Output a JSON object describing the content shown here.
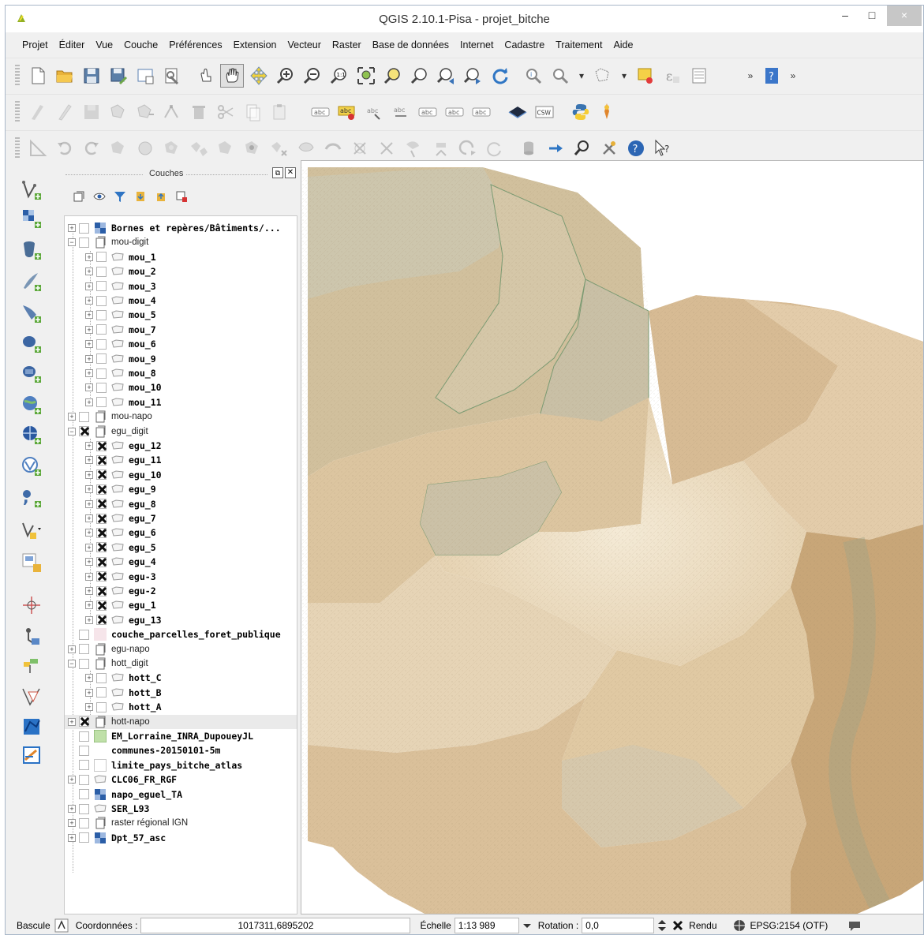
{
  "window": {
    "title": "QGIS 2.10.1-Pisa - projet_bitche",
    "minimize": "–",
    "maximize": "□",
    "close": "×"
  },
  "menu": [
    "Projet",
    "Éditer",
    "Vue",
    "Couche",
    "Préférences",
    "Extension",
    "Vecteur",
    "Raster",
    "Base de données",
    "Internet",
    "Cadastre",
    "Traitement",
    "Aide"
  ],
  "toolbars": {
    "overflow": "»",
    "file": [
      "new-project-icon",
      "open-project-icon",
      "save-project-icon",
      "save-as-icon",
      "print-composer-icon",
      "composer-manager-icon"
    ],
    "navigation": [
      "touch-icon",
      "pan-icon",
      "pan-to-selection-icon",
      "zoom-in-icon",
      "zoom-out-icon",
      "zoom-actual-icon",
      "zoom-full-icon",
      "zoom-to-selection-icon",
      "zoom-to-layer-icon",
      "zoom-last-icon",
      "zoom-next-icon",
      "refresh-icon"
    ],
    "attributes": [
      "identify-icon",
      "select-icon",
      "deselect-icon",
      "open-table-icon",
      "measure-icon",
      "statistics-icon"
    ],
    "help": "help-icon",
    "edit": [
      "current-edits-icon",
      "toggle-editing-icon",
      "save-edits-icon",
      "add-feature-icon",
      "move-feature-icon",
      "node-tool-icon",
      "delete-icon",
      "cut-icon",
      "copy-icon",
      "paste-icon"
    ],
    "labels": {
      "items": [
        "label-tool-icon",
        "pin-label-icon",
        "highlight-label-icon",
        "move-label-icon",
        "rotate-label-icon",
        "change-label-icon",
        "show-hide-label-icon"
      ],
      "text": "abc"
    },
    "web": {
      "catalog": "catalog-icon",
      "csw_text": "CSW"
    },
    "plugins": [
      "python-icon",
      "spatialite-icon"
    ],
    "advanced": [
      "digitize-icon",
      "undo-icon",
      "redo-icon",
      "rotate-feature-icon",
      "simplify-icon",
      "add-ring-icon",
      "add-part-icon",
      "fill-ring-icon",
      "delete-ring-icon",
      "delete-part-icon",
      "reshape-icon",
      "offset-curve-icon",
      "split-feature-icon",
      "split-parts-icon",
      "merge-icon",
      "merge-attributes-icon",
      "rotate-symbol-icon",
      "rotate-point-icon",
      "layer-db-icon",
      "arrow-right-icon",
      "search-icon",
      "tools-icon",
      "whats-this-icon"
    ],
    "whats_this_text": "?"
  },
  "vbar": [
    "add-vector-layer-icon",
    "add-raster-layer-icon",
    "add-postgis-icon",
    "add-spatialite-icon",
    "add-mssql-icon",
    "add-oracle-icon",
    "add-db2-icon",
    "add-wms-icon",
    "add-wcs-icon",
    "add-wfs-icon",
    "add-delimited-icon",
    "new-shapefile-icon",
    "create-layer-icon",
    "add-gps-icon",
    "coordinate-capture-icon",
    "geometry-checker-icon",
    "georeferencer-icon",
    "vector-query-icon",
    "add-wfs-alt-icon",
    "heatmap-icon"
  ],
  "layers_panel": {
    "title": "Couches",
    "float_btn": "⧉",
    "close_btn": "✕",
    "tools": [
      "add-group-icon",
      "manage-visibility-icon",
      "filter-legend-icon",
      "expand-all-icon",
      "collapse-all-icon",
      "remove-layer-icon"
    ],
    "rows": [
      {
        "level": 0,
        "expander": "+",
        "checked": false,
        "icon": "raster",
        "name": "Bornes et repères/Bâtiments/...",
        "style": "bold"
      },
      {
        "level": 0,
        "expander": "−",
        "checked": false,
        "icon": "group",
        "name": "mou-digit",
        "style": "group"
      },
      {
        "level": 1,
        "expander": "+",
        "checked": false,
        "icon": "polygon",
        "name": "mou_1",
        "style": "bold"
      },
      {
        "level": 1,
        "expander": "+",
        "checked": false,
        "icon": "polygon",
        "name": "mou_2",
        "style": "bold"
      },
      {
        "level": 1,
        "expander": "+",
        "checked": false,
        "icon": "polygon",
        "name": "mou_3",
        "style": "bold"
      },
      {
        "level": 1,
        "expander": "+",
        "checked": false,
        "icon": "polygon",
        "name": "mou_4",
        "style": "bold"
      },
      {
        "level": 1,
        "expander": "+",
        "checked": false,
        "icon": "polygon",
        "name": "mou_5",
        "style": "bold"
      },
      {
        "level": 1,
        "expander": "+",
        "checked": false,
        "icon": "polygon",
        "name": "mou_7",
        "style": "bold"
      },
      {
        "level": 1,
        "expander": "+",
        "checked": false,
        "icon": "polygon",
        "name": "mou_6",
        "style": "bold"
      },
      {
        "level": 1,
        "expander": "+",
        "checked": false,
        "icon": "polygon",
        "name": "mou_9",
        "style": "bold"
      },
      {
        "level": 1,
        "expander": "+",
        "checked": false,
        "icon": "polygon",
        "name": "mou_8",
        "style": "bold"
      },
      {
        "level": 1,
        "expander": "+",
        "checked": false,
        "icon": "polygon",
        "name": "mou_10",
        "style": "bold"
      },
      {
        "level": 1,
        "expander": "+",
        "checked": false,
        "icon": "polygon",
        "name": "mou_11",
        "style": "bold"
      },
      {
        "level": 0,
        "expander": "+",
        "checked": false,
        "icon": "group",
        "name": "mou-napo",
        "style": "group"
      },
      {
        "level": 0,
        "expander": "−",
        "checked": true,
        "icon": "group",
        "name": "egu_digit",
        "style": "group"
      },
      {
        "level": 1,
        "expander": "+",
        "checked": true,
        "icon": "polygon",
        "name": "egu_12",
        "style": "bold"
      },
      {
        "level": 1,
        "expander": "+",
        "checked": true,
        "icon": "polygon",
        "name": "egu_11",
        "style": "bold"
      },
      {
        "level": 1,
        "expander": "+",
        "checked": true,
        "icon": "polygon",
        "name": "egu_10",
        "style": "bold"
      },
      {
        "level": 1,
        "expander": "+",
        "checked": true,
        "icon": "polygon",
        "name": "egu_9",
        "style": "bold"
      },
      {
        "level": 1,
        "expander": "+",
        "checked": true,
        "icon": "polygon",
        "name": "egu_8",
        "style": "bold"
      },
      {
        "level": 1,
        "expander": "+",
        "checked": true,
        "icon": "polygon",
        "name": "egu_7",
        "style": "bold"
      },
      {
        "level": 1,
        "expander": "+",
        "checked": true,
        "icon": "polygon",
        "name": "egu_6",
        "style": "bold"
      },
      {
        "level": 1,
        "expander": "+",
        "checked": true,
        "icon": "polygon",
        "name": "egu_5",
        "style": "bold"
      },
      {
        "level": 1,
        "expander": "+",
        "checked": true,
        "icon": "polygon",
        "name": "egu_4",
        "style": "bold"
      },
      {
        "level": 1,
        "expander": "+",
        "checked": true,
        "icon": "polygon",
        "name": "egu-3",
        "style": "bold"
      },
      {
        "level": 1,
        "expander": "+",
        "checked": true,
        "icon": "polygon",
        "name": "egu-2",
        "style": "bold"
      },
      {
        "level": 1,
        "expander": "+",
        "checked": true,
        "icon": "polygon",
        "name": "egu_1",
        "style": "bold"
      },
      {
        "level": 1,
        "expander": "+",
        "checked": true,
        "icon": "polygon",
        "name": "egu_13",
        "style": "bold"
      },
      {
        "level": 0,
        "expander": "",
        "checked": false,
        "icon": "pink",
        "name": "couche_parcelles_foret_publique",
        "style": "bold"
      },
      {
        "level": 0,
        "expander": "+",
        "checked": false,
        "icon": "group",
        "name": "egu-napo",
        "style": "group"
      },
      {
        "level": 0,
        "expander": "−",
        "checked": false,
        "icon": "group",
        "name": "hott_digit",
        "style": "group"
      },
      {
        "level": 1,
        "expander": "+",
        "checked": false,
        "icon": "polygon",
        "name": "hott_C",
        "style": "bold"
      },
      {
        "level": 1,
        "expander": "+",
        "checked": false,
        "icon": "polygon",
        "name": "hott_B",
        "style": "bold"
      },
      {
        "level": 1,
        "expander": "+",
        "checked": false,
        "icon": "polygon",
        "name": "hott_A",
        "style": "bold"
      },
      {
        "level": 0,
        "expander": "+",
        "checked": true,
        "icon": "group",
        "name": "hott-napo",
        "style": "group",
        "selected": true
      },
      {
        "level": 0,
        "expander": "",
        "checked": false,
        "icon": "green",
        "name": "EM_Lorraine_INRA_DupoueyJL",
        "style": "bold"
      },
      {
        "level": 0,
        "expander": "",
        "checked": false,
        "icon": "none",
        "name": "communes-20150101-5m",
        "style": "bold"
      },
      {
        "level": 0,
        "expander": "",
        "checked": false,
        "icon": "white",
        "name": "limite_pays_bitche_atlas",
        "style": "bold"
      },
      {
        "level": 0,
        "expander": "+",
        "checked": false,
        "icon": "polygon",
        "name": "CLC06_FR_RGF",
        "style": "bold"
      },
      {
        "level": 0,
        "expander": "",
        "checked": false,
        "icon": "raster",
        "name": "napo_eguel_TA",
        "style": "bold"
      },
      {
        "level": 0,
        "expander": "+",
        "checked": false,
        "icon": "polygon",
        "name": "SER_L93",
        "style": "bold"
      },
      {
        "level": 0,
        "expander": "+",
        "checked": false,
        "icon": "group",
        "name": "raster régional IGN",
        "style": "group"
      },
      {
        "level": 0,
        "expander": "+",
        "checked": false,
        "icon": "raster",
        "name": "Dpt_57_asc",
        "style": "bold"
      }
    ]
  },
  "colors": {
    "map_background": "#ffffff",
    "parchment_light": "#eee2c9",
    "parchment_mid": "#dcc3a0",
    "parchment_dark": "#c9a97e",
    "grey_parcel": "#d2c7b0",
    "boundary_green": "#6f9a6b"
  },
  "statusbar": {
    "toggle_label": "Bascule",
    "coord_label": "Coordonnées :",
    "coord_value": "1017311,6895202",
    "scale_label": "Échelle",
    "scale_value": "1:13 989",
    "rotation_label": "Rotation :",
    "rotation_value": "0,0",
    "render_label": "Rendu",
    "render_checked": true,
    "crs_label": "EPSG:2154 (OTF)"
  }
}
